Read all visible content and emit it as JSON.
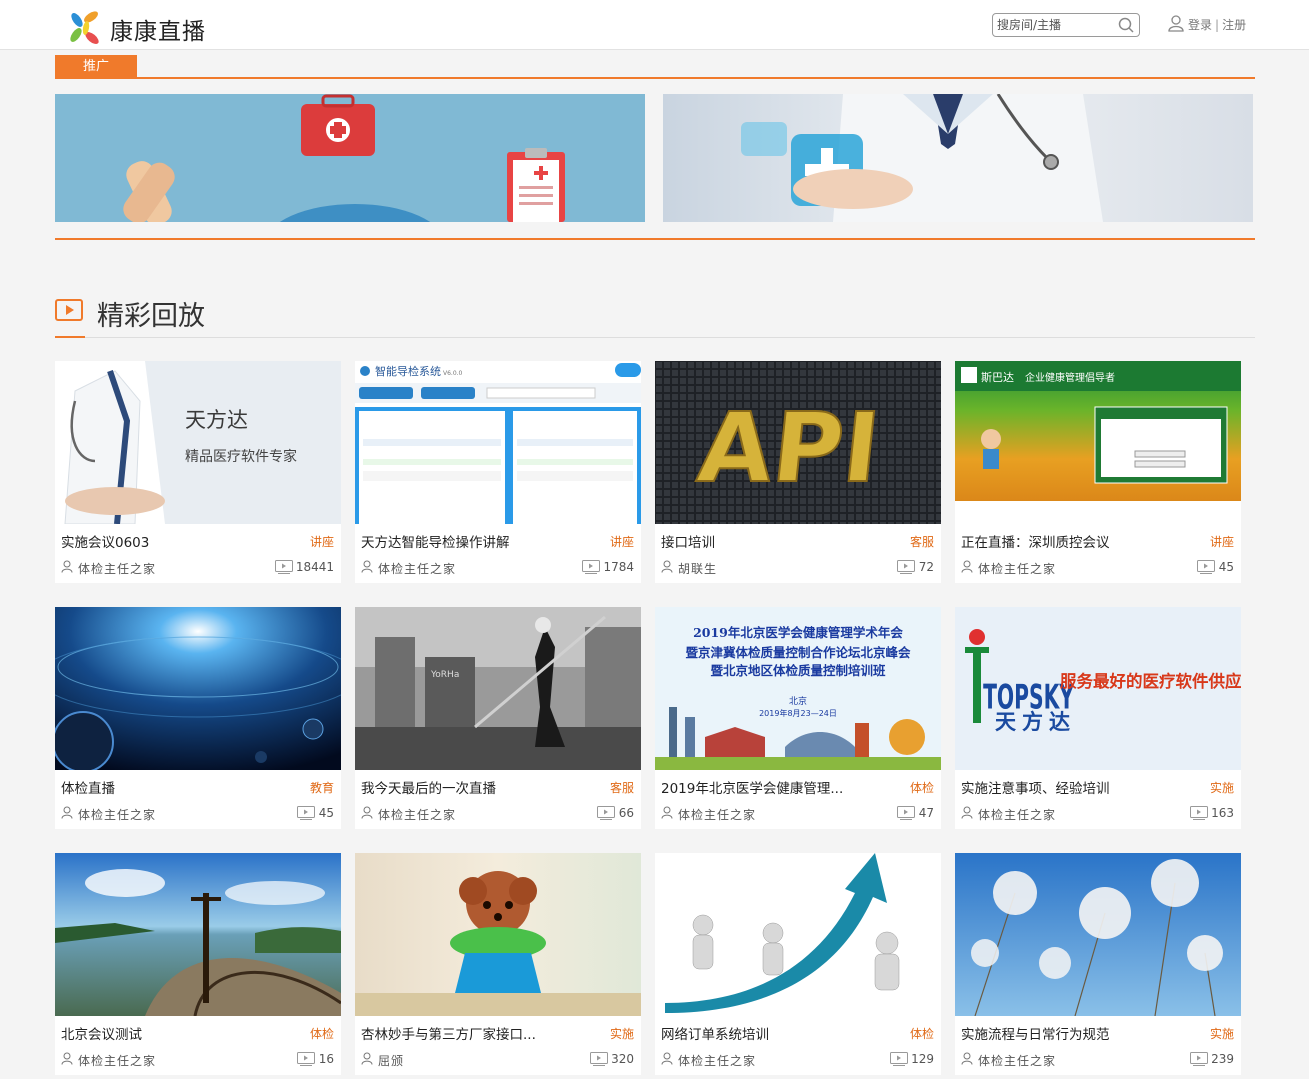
{
  "header": {
    "logo_text": "康康直播",
    "search_placeholder": "搜房间/主播",
    "login": "登录",
    "separator": "|",
    "register": "注册"
  },
  "promo": {
    "tab": "推广"
  },
  "section": {
    "title": "精彩回放"
  },
  "cards": [
    {
      "title": "实施会议0603",
      "tag": "讲座",
      "author": "体检主任之家",
      "views": "18441",
      "thumb_text": "天方达",
      "thumb_sub": "精品医疗软件专家"
    },
    {
      "title": "天方达智能导检操作讲解",
      "tag": "讲座",
      "author": "体检主任之家",
      "views": "1784",
      "thumb_text": "智能导检系统",
      "thumb_sub": "V6.0.0"
    },
    {
      "title": "接口培训",
      "tag": "客服",
      "author": "胡联生",
      "views": "72",
      "thumb_text": "API",
      "thumb_sub": ""
    },
    {
      "title": "正在直播：深圳质控会议",
      "tag": "讲座",
      "author": "体检主任之家",
      "views": "45",
      "thumb_text": "斯巴达",
      "thumb_sub": "企业健康管理倡导者"
    },
    {
      "title": "体检直播",
      "tag": "教育",
      "author": "体检主任之家",
      "views": "45",
      "thumb_text": "",
      "thumb_sub": ""
    },
    {
      "title": "我今天最后的一次直播",
      "tag": "客服",
      "author": "体检主任之家",
      "views": "66",
      "thumb_text": "YoRHa",
      "thumb_sub": ""
    },
    {
      "title": "2019年北京医学会健康管理...",
      "tag": "体检",
      "author": "体检主任之家",
      "views": "47",
      "thumb_text": "2019年北京医学会健康管理学术年会",
      "thumb_sub": "北京",
      "thumb_line2": "暨京津冀体检质量控制合作论坛北京峰会",
      "thumb_line3": "暨北京地区体检质量控制培训班",
      "thumb_date": "2019年8月23—24日"
    },
    {
      "title": "实施注意事项、经验培训",
      "tag": "实施",
      "author": "体检主任之家",
      "views": "163",
      "thumb_text": "TOPSKY",
      "thumb_sub": "天方达",
      "thumb_line2": "服务最好的医疗软件供应商"
    },
    {
      "title": "北京会议测试",
      "tag": "体检",
      "author": "体检主任之家",
      "views": "16",
      "thumb_text": "",
      "thumb_sub": ""
    },
    {
      "title": "杏林妙手与第三方厂家接口...",
      "tag": "实施",
      "author": "屈颁",
      "views": "320",
      "thumb_text": "",
      "thumb_sub": ""
    },
    {
      "title": "网络订单系统培训",
      "tag": "体检",
      "author": "体检主任之家",
      "views": "129",
      "thumb_text": "",
      "thumb_sub": ""
    },
    {
      "title": "实施流程与日常行为规范",
      "tag": "实施",
      "author": "体检主任之家",
      "views": "239",
      "thumb_text": "",
      "thumb_sub": ""
    }
  ],
  "colors": {
    "accent": "#f07a2b",
    "tag": "#e06a17"
  }
}
